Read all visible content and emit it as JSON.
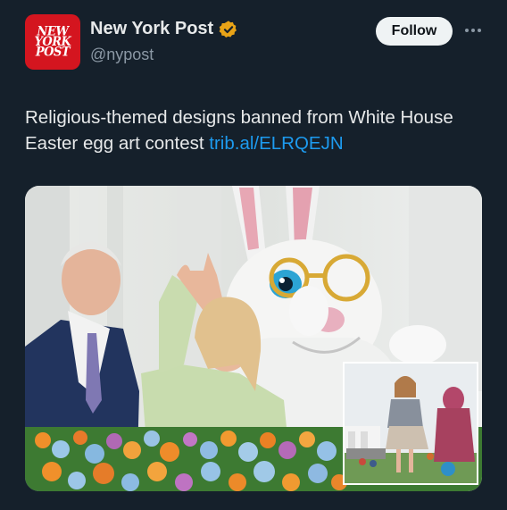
{
  "author": {
    "logo_text": "NEW\nYORK\nPOST",
    "display_name": "New York Post",
    "handle": "@nypost",
    "verified": true,
    "verified_color": "#e8a317"
  },
  "actions": {
    "follow_label": "Follow",
    "more_icon": "more-horizontal-icon"
  },
  "tweet": {
    "text": "Religious-themed designs banned from White House Easter egg art contest ",
    "link": "trib.al/ELRQEJN"
  },
  "colors": {
    "background": "#15202b",
    "text": "#e7e9ea",
    "secondary_text": "#8b98a5",
    "link": "#1d9bf0",
    "brand_red": "#d4151f"
  }
}
